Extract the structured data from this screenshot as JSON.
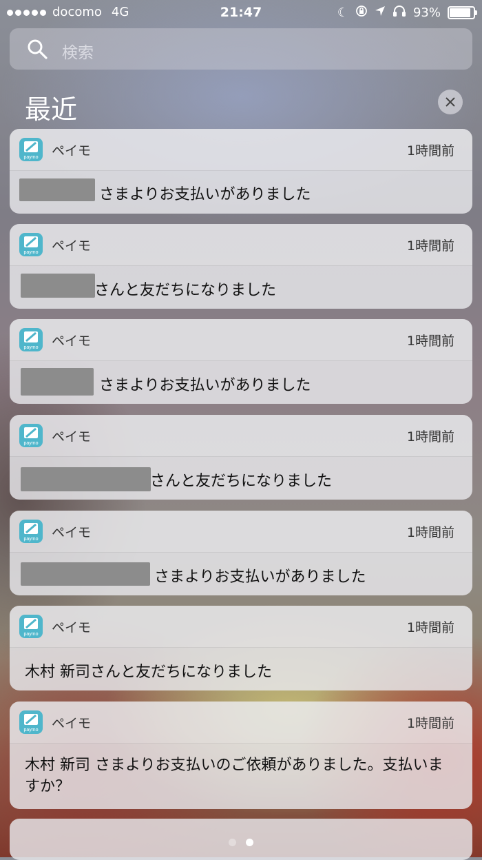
{
  "status_bar": {
    "carrier": "docomo",
    "network": "4G",
    "time": "21:47",
    "battery": "93%",
    "battery_level": 0.93,
    "icons": [
      "moon-icon",
      "orientation-lock-icon",
      "location-arrow-icon",
      "headphones-icon"
    ]
  },
  "search": {
    "placeholder": "検索"
  },
  "section": {
    "title": "最近"
  },
  "notifications": [
    {
      "app": "ペイモ",
      "time": "1時間前",
      "message": "さまよりお支払いがありました"
    },
    {
      "app": "ペイモ",
      "time": "1時間前",
      "message": "さんと友だちになりました"
    },
    {
      "app": "ペイモ",
      "time": "1時間前",
      "message": "さまよりお支払いがありました"
    },
    {
      "app": "ペイモ",
      "time": "1時間前",
      "message": "さんと友だちになりました"
    },
    {
      "app": "ペイモ",
      "time": "1時間前",
      "message": "さまよりお支払いがありました"
    },
    {
      "app": "ペイモ",
      "time": "1時間前",
      "message": "木村 新司さんと友だちになりました"
    },
    {
      "app": "ペイモ",
      "time": "1時間前",
      "message": "木村 新司 さまよりお支払いのご依頼がありました。支払いますか？"
    }
  ],
  "app_icon": {
    "label": "paymo",
    "color": "#4fb6cb"
  },
  "pager": {
    "pages": 2,
    "current": 2
  }
}
